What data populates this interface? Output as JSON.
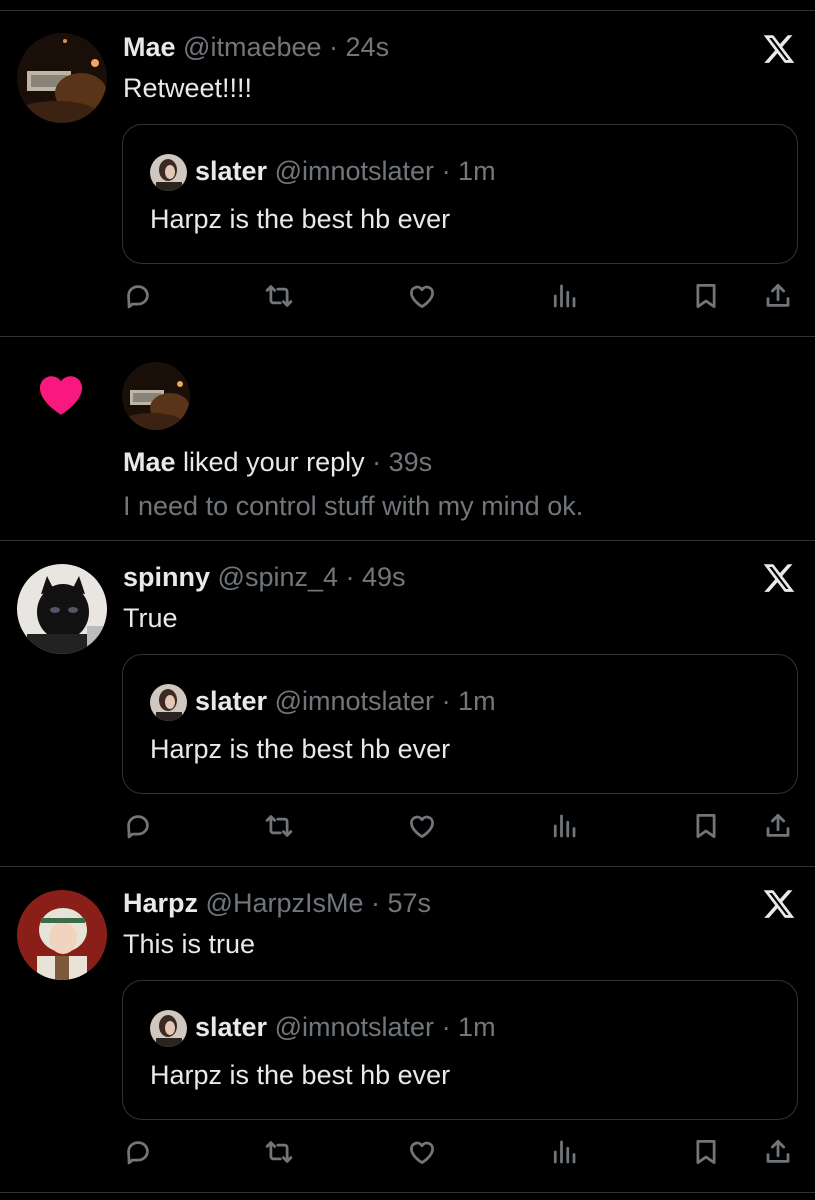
{
  "colors": {
    "background": "#000000",
    "text": "#e7e9ea",
    "muted": "#71767b",
    "divider": "#2f3336",
    "like_pink": "#f91880"
  },
  "quoted": {
    "name": "slater",
    "handle": "@imnotslater",
    "time": "· 1m",
    "text": "Harpz is the best hb ever"
  },
  "feed": {
    "tweet1": {
      "name": "Mae",
      "handle": "@itmaebee",
      "time": "· 24s",
      "text": "Retweet!!!!"
    },
    "notification": {
      "icon": "heart-icon",
      "name": "Mae",
      "action": "liked your reply",
      "time": "· 39s",
      "quote": "I need to control stuff with my mind ok."
    },
    "tweet2": {
      "name": "spinny",
      "handle": "@spinz_4",
      "time": "· 49s",
      "text": "True"
    },
    "tweet3": {
      "name": "Harpz",
      "handle": "@HarpzIsMe",
      "time": "· 57s",
      "text": "This is true"
    }
  },
  "icons": {
    "reply": "reply-icon",
    "retweet": "retweet-icon",
    "like": "like-icon",
    "views": "views-icon",
    "bookmark": "bookmark-icon",
    "share": "share-icon",
    "platform": "x-logo-icon"
  }
}
